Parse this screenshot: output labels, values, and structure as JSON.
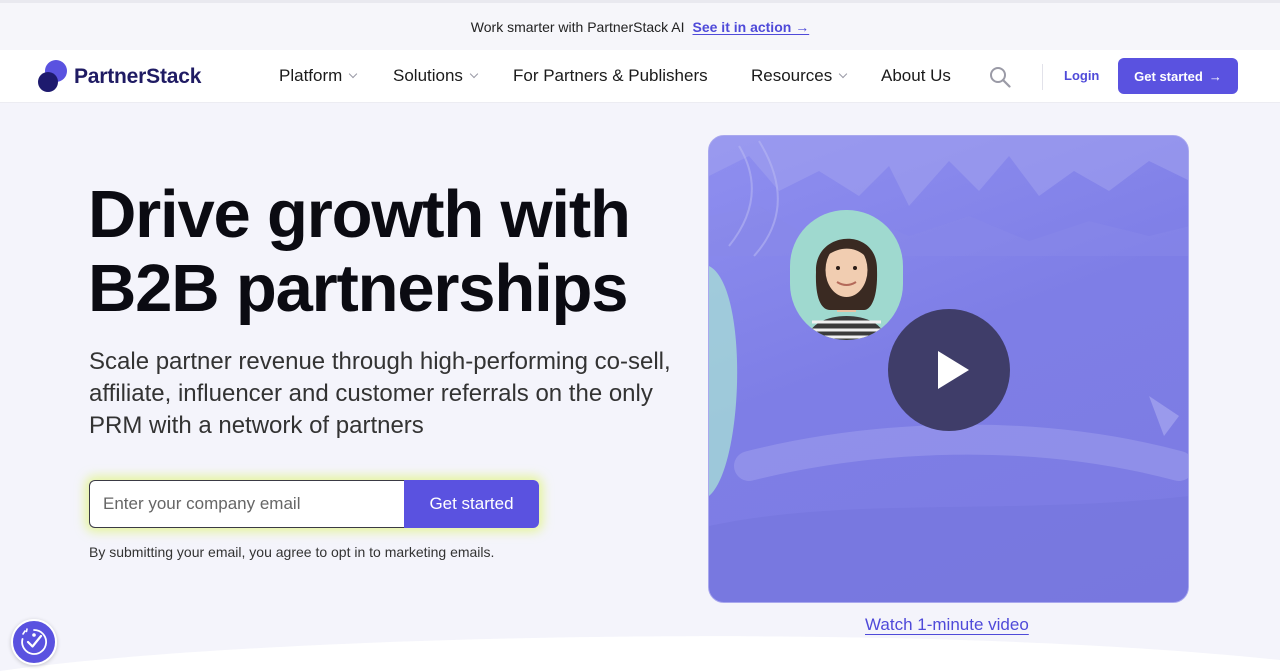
{
  "announcement": {
    "text": "Work smarter with PartnerStack AI",
    "link": "See it in action →"
  },
  "nav": {
    "logo_text": "PartnerStack",
    "items": [
      {
        "label": "Platform",
        "dropdown": true
      },
      {
        "label": "Solutions",
        "dropdown": true
      },
      {
        "label": "For Partners & Publishers",
        "dropdown": false
      },
      {
        "label": "Resources",
        "dropdown": true
      },
      {
        "label": "About Us",
        "dropdown": false
      }
    ],
    "search_icon": "search-icon",
    "login": "Login",
    "cta": "Get started",
    "cta_arrow": "→"
  },
  "hero": {
    "title_line1": "Drive growth with",
    "title_line2": "B2B partnerships",
    "subtitle": "Scale partner revenue through high-performing co-sell, affiliate, influencer and customer referrals on the only PRM with a network of partners",
    "email_placeholder": "Enter your company email",
    "email_value": "",
    "cta": "Get started",
    "disclaimer": "By submitting your email, you agree to opt in to marketing emails."
  },
  "video": {
    "play_icon": "play-icon",
    "link": "Watch 1-minute video"
  },
  "colors": {
    "brand": "#5a52e0",
    "brand_dark": "#1f1b63",
    "link": "#4f4ad9",
    "play_button": "#3f3d69",
    "input_glow": "#daf656"
  }
}
